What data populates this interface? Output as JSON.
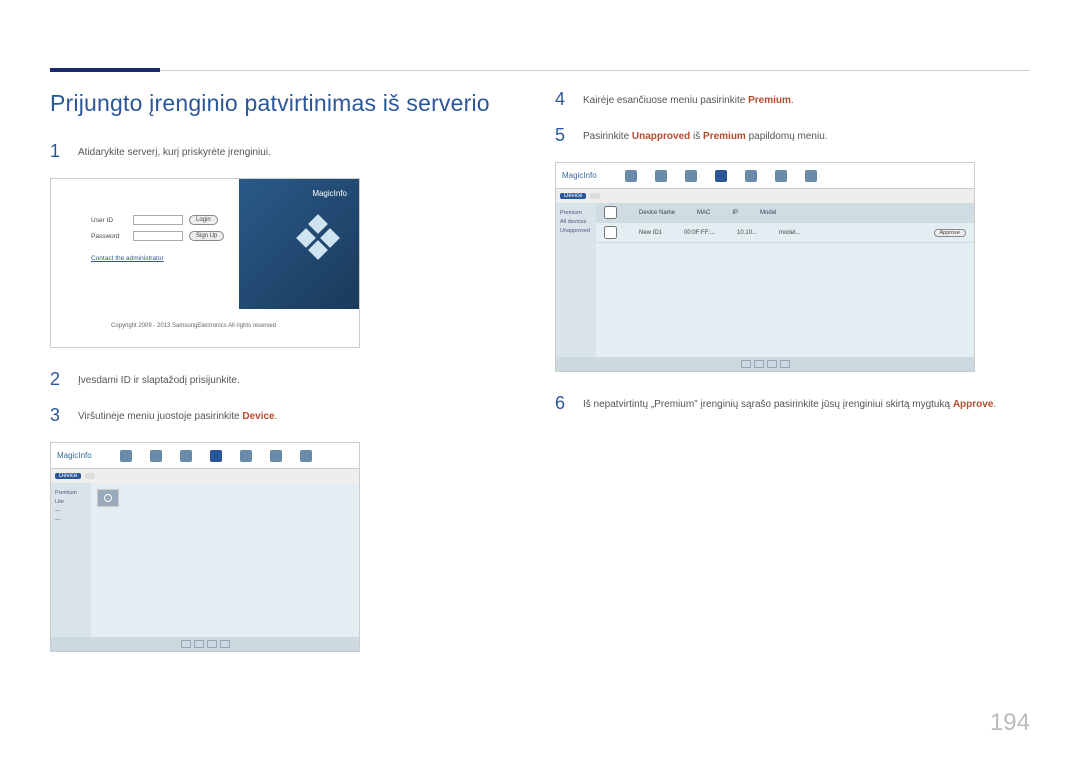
{
  "heading": "Prijungto įrenginio patvirtinimas iš serverio",
  "page_number": "194",
  "steps": {
    "s1": {
      "num": "1",
      "text": "Atidarykite serverį, kurį priskyrėte įrenginiui."
    },
    "s2": {
      "num": "2",
      "text": "Įvesdami ID ir slaptažodį prisijunkite."
    },
    "s3": {
      "num": "3",
      "prefix": "Viršutinėje meniu juostoje pasirinkite ",
      "hl": "Device",
      "suffix": "."
    },
    "s4": {
      "num": "4",
      "prefix": "Kairėje esančiuose meniu pasirinkite ",
      "hl": "Premium",
      "suffix": "."
    },
    "s5": {
      "num": "5",
      "p1": "Pasirinkite ",
      "hl1": "Unapproved",
      "p2": " iš ",
      "hl2": "Premium",
      "p3": " papildomų meniu."
    },
    "s6": {
      "num": "6",
      "prefix": "Iš nepatvirtintų „Premium\" įrenginių sąrašo pasirinkite jūsų įrenginiui skirtą mygtuką ",
      "hl": "Approve",
      "suffix": "."
    }
  },
  "login": {
    "user_label": "User ID",
    "pass_label": "Password",
    "login_btn": "Login",
    "signup_btn": "Sign Up",
    "admin_link": "Contact the administrator",
    "brand": "MagicInfo",
    "copyright": "Copyright 2009 - 2013 SamsungElectronics All rights reserved"
  },
  "app": {
    "brand": "MagicInfo",
    "sidebar": [
      "Premium",
      "Lite",
      "—",
      "—",
      "—",
      "—"
    ]
  },
  "list": {
    "headers": [
      "",
      "Device Name",
      "MAC",
      "IP",
      "Model",
      ""
    ],
    "row": [
      "",
      "New ID1",
      "00:0F:FF:...",
      "10.10...",
      "model...",
      "Approve"
    ]
  }
}
